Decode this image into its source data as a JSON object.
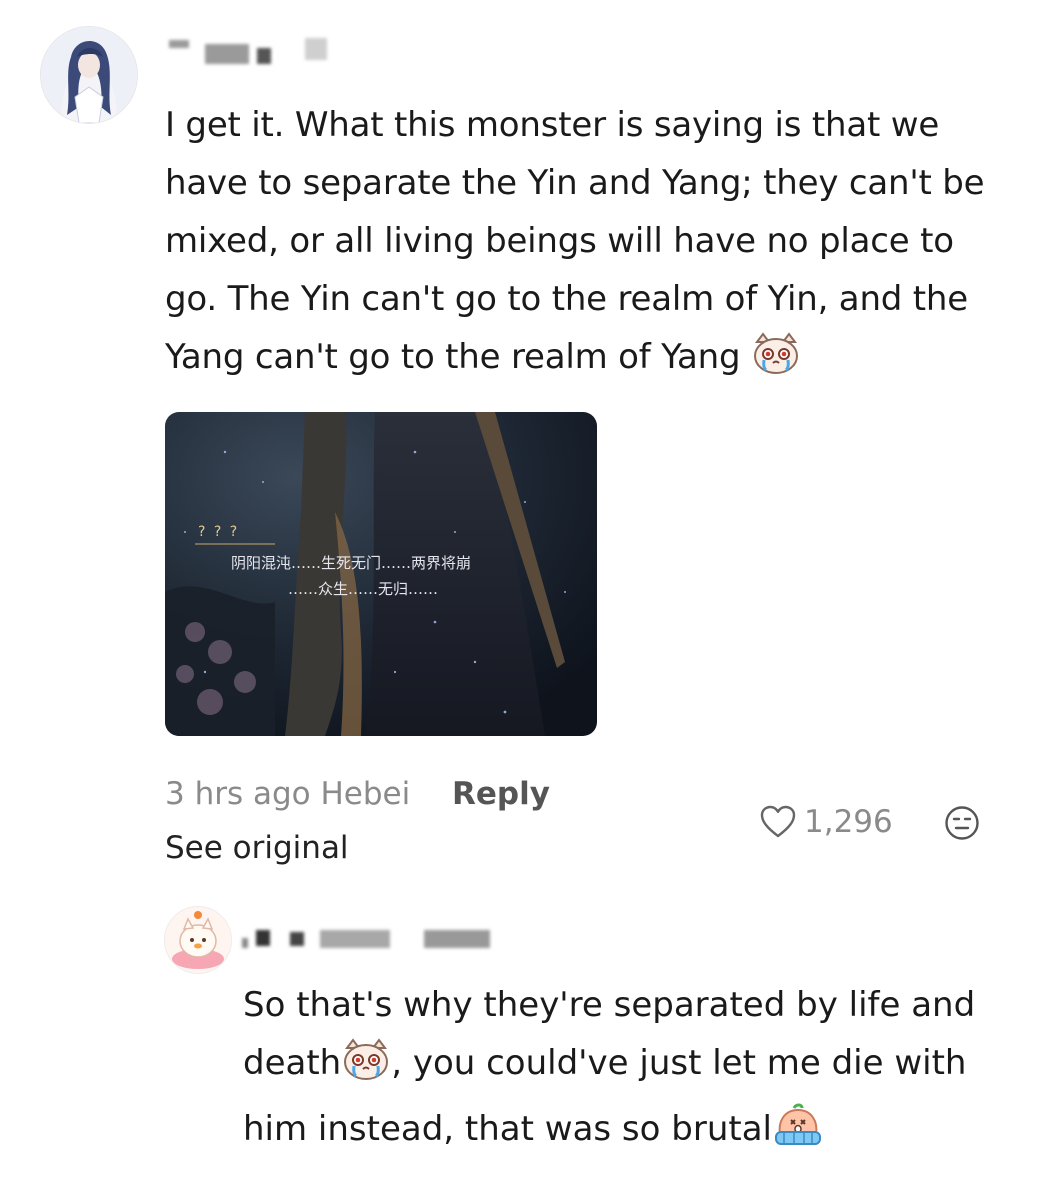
{
  "comment": {
    "text_before_emoji": "I get it. What this monster is saying is that we have to separate the Yin and Yang; they can't be mixed, or all living beings will have no place to go. The Yin can't go to the realm of Yin, and the Yang can't go to the realm of Yang",
    "emoji_1": "crying-cat-emoji",
    "media": {
      "speaker": "? ? ?",
      "subtitle_line1": "阴阳混沌……生死无门……两界将崩",
      "subtitle_line2": "……众生……无归……"
    },
    "time_location": "3 hrs ago Hebei",
    "reply_label": "Reply",
    "see_original_label": "See original",
    "likes": "1,296",
    "like_icon": "heart-outline-icon",
    "reaction_icon": "neutral-face-icon"
  },
  "reply": {
    "text_part1": "So that's why they're separated by life and death",
    "emoji_1": "crying-cat-emoji",
    "text_part2": ", you could've just let me die with him instead, that was so brutal",
    "emoji_2": "crying-peach-emoji"
  },
  "colors": {
    "text": "#1a1a1a",
    "muted": "#8a8a8a",
    "reply_action": "#555555",
    "media_bg": "#1f2a36",
    "subtitle_text": "#e6e6ee"
  }
}
